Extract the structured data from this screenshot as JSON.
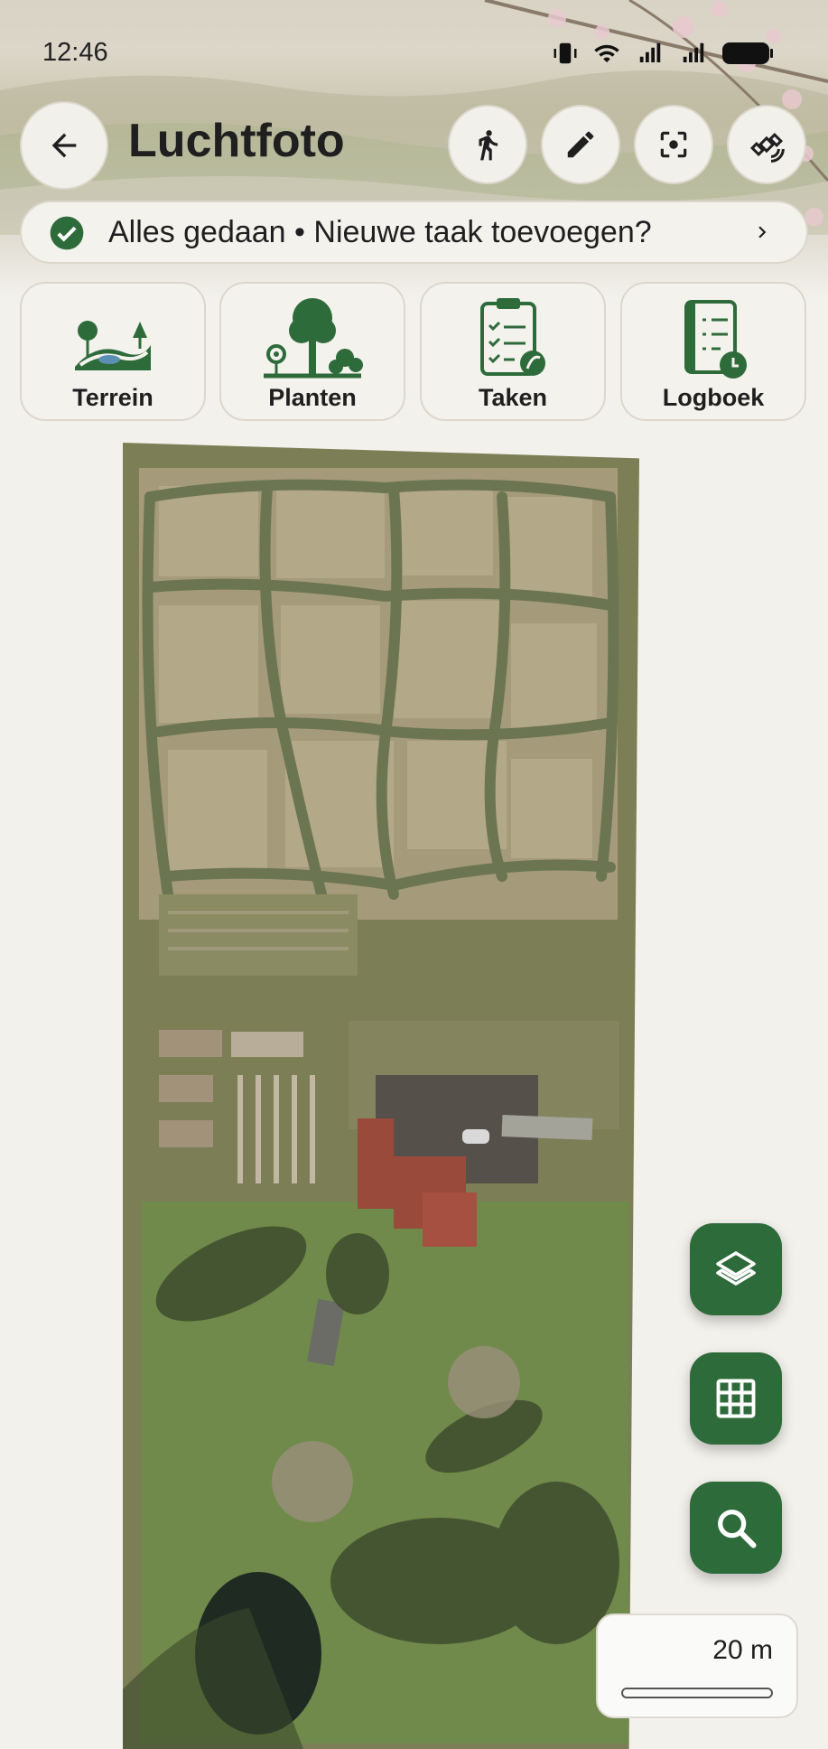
{
  "status_bar": {
    "time": "12:46"
  },
  "header": {
    "title": "Luchtfoto"
  },
  "banner": {
    "text": "Alles gedaan • Nieuwe taak toevoegen?"
  },
  "cards": [
    {
      "label": "Terrein",
      "icon": "terrain-icon"
    },
    {
      "label": "Planten",
      "icon": "plants-icon"
    },
    {
      "label": "Taken",
      "icon": "tasks-icon"
    },
    {
      "label": "Logboek",
      "icon": "logbook-icon"
    }
  ],
  "map": {
    "scale_label": "20 m"
  },
  "colors": {
    "accent": "#2e6b3a",
    "background": "#f3f1ec"
  }
}
